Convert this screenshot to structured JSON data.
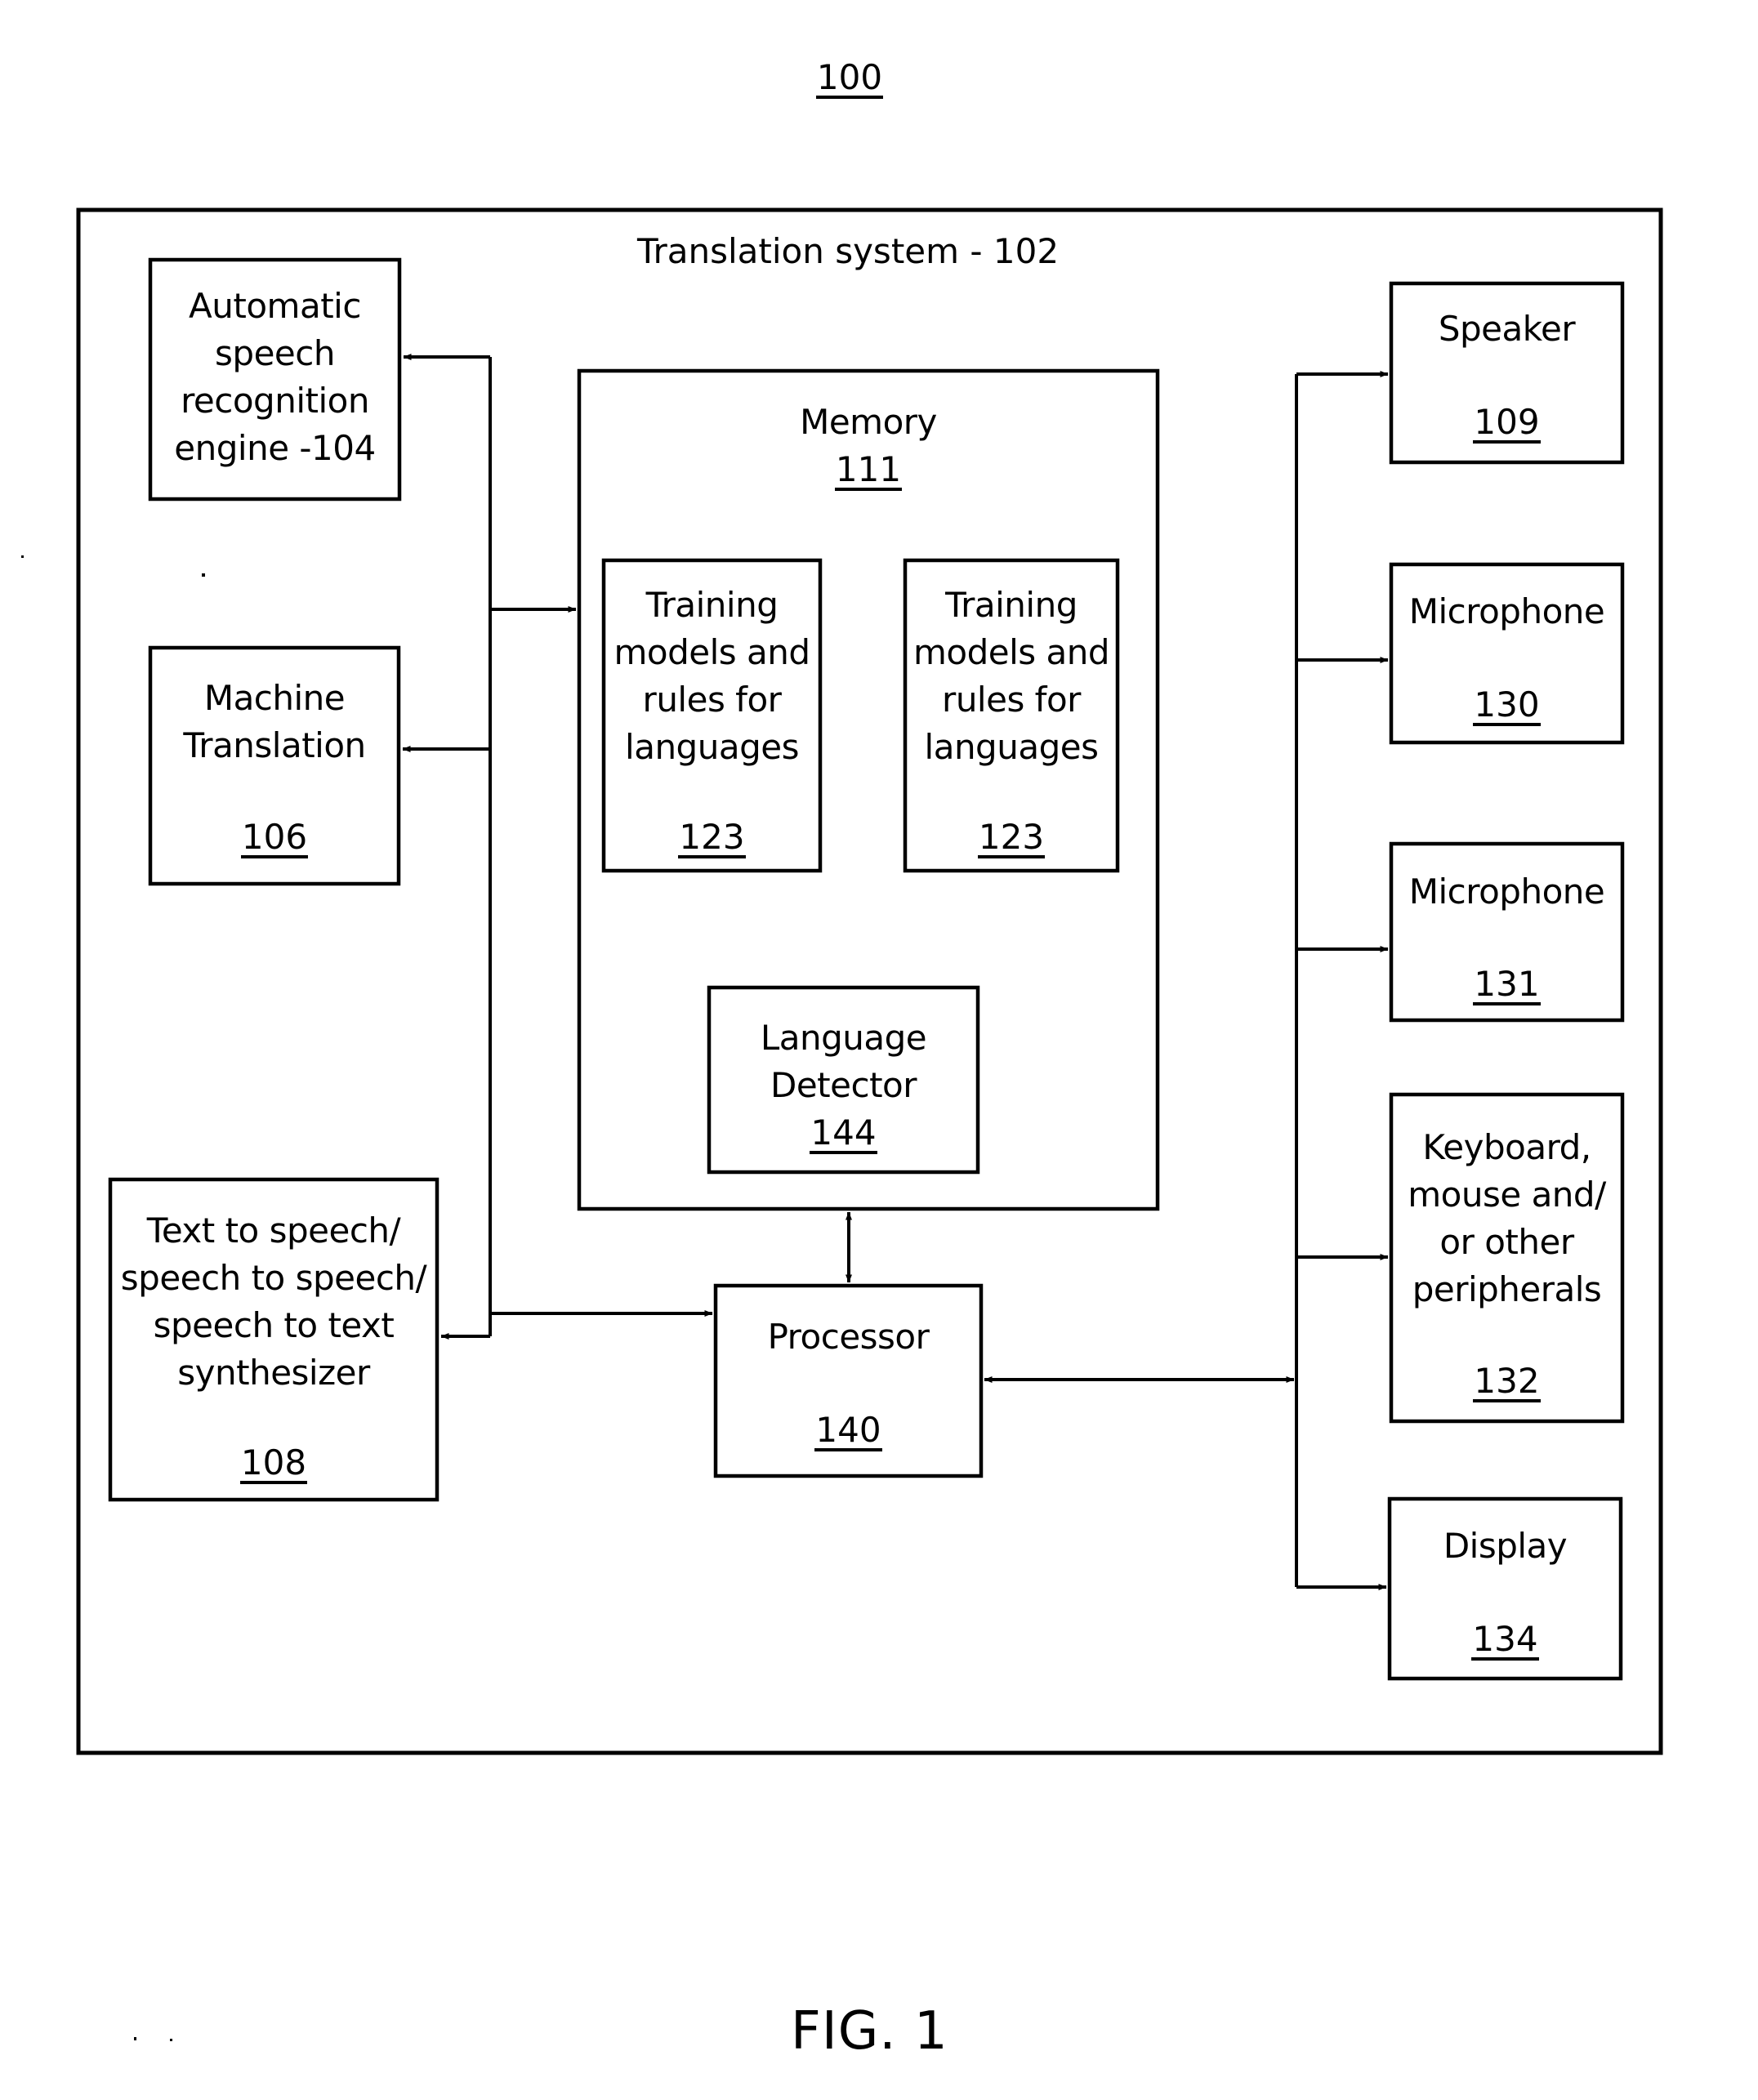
{
  "figure": {
    "reference": "100",
    "caption": "FIG. 1"
  },
  "system": {
    "title": "Translation system  - 102"
  },
  "components": {
    "asr": {
      "label": "Automatic\nspeech\nrecognition\nengine -104"
    },
    "mt": {
      "label": "Machine\nTranslation",
      "ref": "106"
    },
    "tts": {
      "label": "Text to speech/\nspeech to speech/\nspeech to text\nsynthesizer",
      "ref": "108"
    },
    "memory": {
      "label": "Memory",
      "ref": "111"
    },
    "training_1": {
      "label": "Training\nmodels and\nrules for\nlanguages",
      "ref": "123"
    },
    "training_2": {
      "label": "Training\nmodels and\nrules for\nlanguages",
      "ref": "123"
    },
    "language_detector": {
      "label": "Language\nDetector",
      "ref": "144"
    },
    "processor": {
      "label": "Processor",
      "ref": "140"
    },
    "speaker": {
      "label": "Speaker",
      "ref": "109"
    },
    "microphone_130": {
      "label": "Microphone",
      "ref": "130"
    },
    "microphone_131": {
      "label": "Microphone",
      "ref": "131"
    },
    "peripherals": {
      "label": "Keyboard,\nmouse and/\nor other\nperipherals",
      "ref": "132"
    },
    "display": {
      "label": "Display",
      "ref": "134"
    }
  },
  "connections": [
    {
      "from": "left-bus",
      "to": "asr",
      "arrow": "to"
    },
    {
      "from": "left-bus",
      "to": "mt",
      "arrow": "to"
    },
    {
      "from": "left-bus",
      "to": "tts",
      "arrow": "to"
    },
    {
      "from": "left-bus",
      "to": "memory",
      "arrow": "to"
    },
    {
      "from": "left-bus",
      "to": "processor",
      "arrow": "to"
    },
    {
      "from": "memory",
      "to": "processor",
      "arrow": "both"
    },
    {
      "from": "processor",
      "to": "right-bus",
      "arrow": "both"
    },
    {
      "from": "right-bus",
      "to": "speaker",
      "arrow": "to"
    },
    {
      "from": "right-bus",
      "to": "microphone_130",
      "arrow": "to"
    },
    {
      "from": "right-bus",
      "to": "microphone_131",
      "arrow": "to"
    },
    {
      "from": "right-bus",
      "to": "peripherals",
      "arrow": "to"
    },
    {
      "from": "right-bus",
      "to": "display",
      "arrow": "to"
    }
  ],
  "colors": {
    "ink": "#000000",
    "paper": "#ffffff"
  }
}
